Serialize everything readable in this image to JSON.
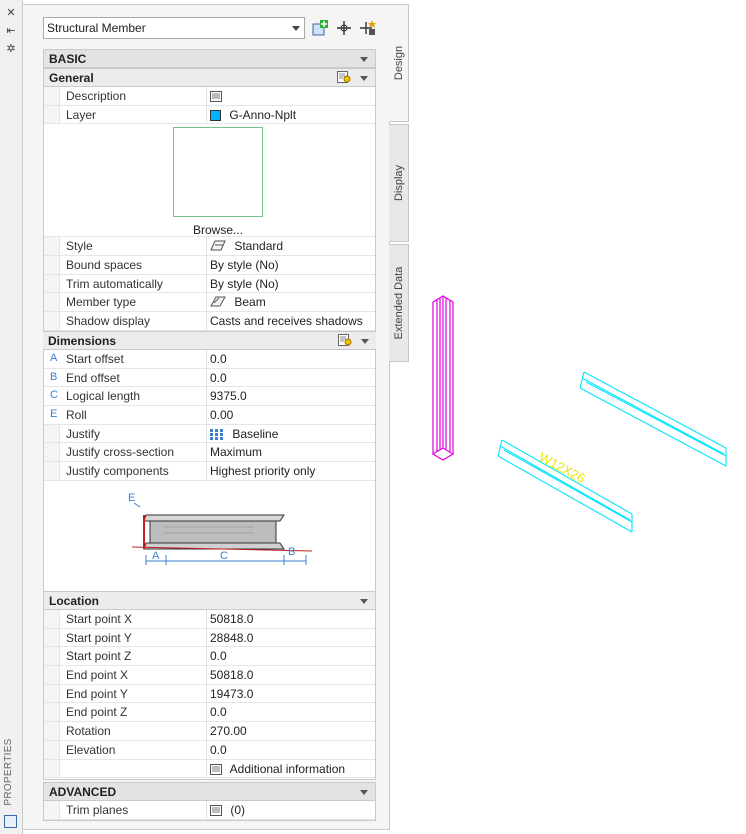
{
  "palette": {
    "title": "PROPERTIES",
    "tabs": [
      "Design",
      "Display",
      "Extended Data"
    ],
    "object_type": "Structural Member",
    "tools": [
      "add-selected-icon",
      "quick-select-icon",
      "toggle-pickadd-icon"
    ]
  },
  "basic": {
    "label": "BASIC",
    "general": {
      "label": "General",
      "rows": [
        {
          "key": "Description",
          "val": ""
        },
        {
          "key": "Layer",
          "val": "G-Anno-Nplt"
        }
      ],
      "browse_label": "Browse...",
      "rows2": [
        {
          "key": "Style",
          "val": "Standard"
        },
        {
          "key": "Bound spaces",
          "val": "By style (No)"
        },
        {
          "key": "Trim automatically",
          "val": "By style (No)"
        },
        {
          "key": "Member type",
          "val": "Beam"
        },
        {
          "key": "Shadow display",
          "val": "Casts and receives shadows"
        }
      ]
    },
    "dimensions": {
      "label": "Dimensions",
      "rows": [
        {
          "letter": "A",
          "key": "Start offset",
          "val": "0.0"
        },
        {
          "letter": "B",
          "key": "End offset",
          "val": "0.0"
        },
        {
          "letter": "C",
          "key": "Logical length",
          "val": "9375.0"
        },
        {
          "letter": "E",
          "key": "Roll",
          "val": "0.00"
        },
        {
          "letter": "",
          "key": "Justify",
          "val": "Baseline"
        },
        {
          "letter": "",
          "key": "Justify cross-section",
          "val": "Maximum"
        },
        {
          "letter": "",
          "key": "Justify components",
          "val": "Highest priority only"
        }
      ],
      "diagram_letters": [
        "E",
        "A",
        "C",
        "B"
      ]
    }
  },
  "location": {
    "label": "Location",
    "rows": [
      {
        "key": "Start point X",
        "val": "50818.0"
      },
      {
        "key": "Start point Y",
        "val": "28848.0"
      },
      {
        "key": "Start point Z",
        "val": "0.0"
      },
      {
        "key": "End point X",
        "val": "50818.0"
      },
      {
        "key": "End point Y",
        "val": "19473.0"
      },
      {
        "key": "End point Z",
        "val": "0.0"
      },
      {
        "key": "Rotation",
        "val": "270.00"
      },
      {
        "key": "Elevation",
        "val": "0.0"
      },
      {
        "key": "",
        "val": "Additional information"
      }
    ]
  },
  "advanced": {
    "label": "ADVANCED",
    "rows": [
      {
        "key": "Trim planes",
        "val": "(0)"
      }
    ]
  },
  "viewport": {
    "beam_label": "W12X26",
    "colors": {
      "magenta": "#e000e0",
      "cyan": "#00e5ff",
      "yellow": "#e8e800"
    }
  }
}
